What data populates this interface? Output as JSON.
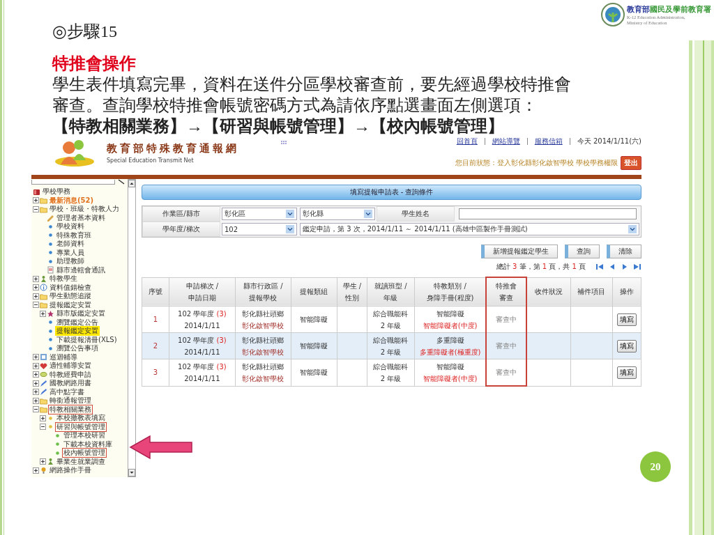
{
  "slide": {
    "step": "◎步驟15",
    "heading": "特推會操作",
    "paragraph": "學生表件填寫完畢，資料在送件分區學校審查前，要先經過學校特推會審查。查詢學校特推會帳號密碼方式為請依序點選畫面左側選項：",
    "path": "【特教相關業務】→【研習與帳號管理】→【校內帳號管理】",
    "page_number": "20"
  },
  "agency_logo": {
    "name_part_1": "教育部",
    "name_part_2": "國民及學前教育署",
    "english": [
      "K-12 Education Administration,",
      "Ministry of Education"
    ]
  },
  "site": {
    "header": {
      "title": "教育部特殊教育通報網",
      "subtitle": "Special Education Transmit Net",
      "links": [
        "回首頁",
        "網站導覽",
        "服務信箱"
      ],
      "date": "今天 2014/1/11(六)",
      "status": "您目前狀態：登入彰化縣彰化啟智學校 學校學務權限",
      "logout": "登出"
    },
    "sidebar": {
      "tree": {
        "label": "學校學務",
        "kind": "book",
        "selected": false,
        "outlined": false,
        "children": [
          {
            "label": "最新消息(52)",
            "kind": "folder",
            "expanded": false,
            "selected": false,
            "outlined": false,
            "color": "#e2711d"
          },
          {
            "label": "學校・班級・特教人力",
            "kind": "folder",
            "expanded": true,
            "selected": false,
            "outlined": false,
            "children": [
              {
                "label": "管理者基本資料",
                "kind": "pen",
                "selected": false,
                "outlined": false
              },
              {
                "label": "學校資料",
                "kind": "dot-blue",
                "selected": false,
                "outlined": false
              },
              {
                "label": "特殊教育班",
                "kind": "dot-blue",
                "selected": false,
                "outlined": false
              },
              {
                "label": "老師資料",
                "kind": "dot-blue",
                "selected": false,
                "outlined": false
              },
              {
                "label": "專業人員",
                "kind": "dot-blue",
                "selected": false,
                "outlined": false
              },
              {
                "label": "助理教師",
                "kind": "dot-blue",
                "selected": false,
                "outlined": false
              },
              {
                "label": "縣市邊轄會通訊",
                "kind": "doc",
                "selected": false,
                "outlined": false
              }
            ]
          },
          {
            "label": "特教學生",
            "kind": "person",
            "expanded": false,
            "selected": false,
            "outlined": false
          },
          {
            "label": "資料值錯檢查",
            "kind": "info",
            "expanded": false,
            "selected": false,
            "outlined": false
          },
          {
            "label": "學生動態追蹤",
            "kind": "folder",
            "expanded": false,
            "selected": false,
            "outlined": false
          },
          {
            "label": "提報鑑定安置",
            "kind": "folder",
            "expanded": true,
            "selected": false,
            "outlined": false,
            "children": [
              {
                "label": "縣市版鑑定安置",
                "kind": "star",
                "expanded": false,
                "selected": false,
                "outlined": false
              },
              {
                "label": "瀏覽鑑定公告",
                "kind": "dot-blue",
                "selected": false,
                "outlined": false
              },
              {
                "label": "提報鑑定安置",
                "kind": "dot-blue",
                "selected": true,
                "outlined": false
              },
              {
                "label": "下載提報清冊(XLS)",
                "kind": "dot-blue",
                "selected": false,
                "outlined": false
              },
              {
                "label": "瀏覽公告事項",
                "kind": "dot-blue",
                "selected": false,
                "outlined": false
              }
            ]
          },
          {
            "label": "巡迴輔導",
            "kind": "board",
            "expanded": false,
            "selected": false,
            "outlined": false
          },
          {
            "label": "適性輔導安置",
            "kind": "heart",
            "expanded": false,
            "selected": false,
            "outlined": false
          },
          {
            "label": "特教經費申請",
            "kind": "leaf",
            "expanded": false,
            "selected": false,
            "outlined": false
          },
          {
            "label": "國教網路用書",
            "kind": "pencil",
            "expanded": false,
            "selected": false,
            "outlined": false
          },
          {
            "label": "高中點字書",
            "kind": "pencil",
            "expanded": false,
            "selected": false,
            "outlined": false
          },
          {
            "label": "轉銜通報管理",
            "kind": "folder",
            "expanded": false,
            "selected": false,
            "outlined": false
          },
          {
            "label": "特教相關業務",
            "kind": "folder",
            "expanded": true,
            "selected": false,
            "outlined": true,
            "children": [
              {
                "label": "本校撤教表填寫",
                "kind": "dot-yellow",
                "expanded": false,
                "selected": false,
                "outlined": false
              },
              {
                "label": "研習與帳號管理",
                "kind": "dot-yellow",
                "expanded": true,
                "selected": false,
                "outlined": true,
                "children": [
                  {
                    "label": "管理本校研習",
                    "kind": "dot-green",
                    "selected": false,
                    "outlined": false
                  },
                  {
                    "label": "下載本校資料庫",
                    "kind": "dot-green",
                    "selected": false,
                    "outlined": false
                  },
                  {
                    "label": "校內帳號管理",
                    "kind": "dot-green",
                    "selected": false,
                    "outlined": true
                  }
                ]
              },
              {
                "label": "畢業生就業調查",
                "kind": "person",
                "expanded": false,
                "selected": false,
                "outlined": false
              }
            ]
          },
          {
            "label": "網路操作手冊",
            "kind": "bulb",
            "expanded": false,
            "selected": false,
            "outlined": false
          }
        ]
      }
    },
    "query": {
      "title": "填寫提報申請表 - 查詢條件",
      "area_label": "作業區/縣市",
      "area_values": [
        "彰化區",
        "彰化縣"
      ],
      "name_label": "學生姓名",
      "term_label": "學年度/梯次",
      "term_values": [
        "102",
        "鑑定申請，第 3 次，2014/1/11 ～ 2014/1/11 (高雄中區製作手冊測試)"
      ]
    },
    "buttons": [
      "新增提報鑑定學生",
      "查詢",
      "清除"
    ],
    "pager": [
      "總計 ",
      "3",
      " 筆，第 ",
      "1",
      " 頁，共 ",
      "1",
      " 頁"
    ],
    "table": {
      "columns": [
        {
          "lines": [
            "序號"
          ],
          "outlined": false
        },
        {
          "lines": [
            "申請梯次 /",
            "申請日期"
          ],
          "outlined": false
        },
        {
          "lines": [
            "縣市行政區 /",
            "提報學校"
          ],
          "outlined": false
        },
        {
          "lines": [
            "提報類組"
          ],
          "outlined": false
        },
        {
          "lines": [
            "學生 /",
            "性別"
          ],
          "outlined": false
        },
        {
          "lines": [
            "就讀班型 /",
            "年級"
          ],
          "outlined": false
        },
        {
          "lines": [
            "特教類別 /",
            "身障手冊(程度)"
          ],
          "outlined": false
        },
        {
          "lines": [
            "特推會",
            "審查"
          ],
          "outlined": true
        },
        {
          "lines": [
            "收件狀況"
          ],
          "outlined": false
        },
        {
          "lines": [
            "補件項目"
          ],
          "outlined": false
        },
        {
          "lines": [
            "操作"
          ],
          "outlined": false
        }
      ],
      "rows": [
        {
          "selected": false,
          "seq": "1",
          "term": "102 學年度",
          "term_count": "(3)",
          "date": "2014/1/11",
          "district": "彰化縣社頭鄉",
          "school": "彰化啟智學校",
          "group": "智能障礙",
          "class_type": "綜合職能科",
          "grade": "2 年級",
          "category": "智能障礙",
          "handbook": "智能障礙者(中度)",
          "review": "審查中",
          "action": "填寫"
        },
        {
          "selected": true,
          "seq": "2",
          "term": "102 學年度",
          "term_count": "(3)",
          "date": "2014/1/11",
          "district": "彰化縣社頭鄉",
          "school": "彰化啟智學校",
          "group": "智能障礙",
          "class_type": "綜合職能科",
          "grade": "2 年級",
          "category": "多重障礙",
          "handbook": "多重障礙者(極重度)",
          "review": "審查中",
          "action": "填寫"
        },
        {
          "selected": false,
          "seq": "3",
          "term": "102 學年度",
          "term_count": "(3)",
          "date": "2014/1/11",
          "district": "彰化縣社頭鄉",
          "school": "彰化啟智學校",
          "group": "智能障礙",
          "class_type": "綜合職能科",
          "grade": "2 年級",
          "category": "智能障礙",
          "handbook": "智能障礙者(中度)",
          "review": "審查中",
          "action": "填寫"
        }
      ]
    }
  }
}
